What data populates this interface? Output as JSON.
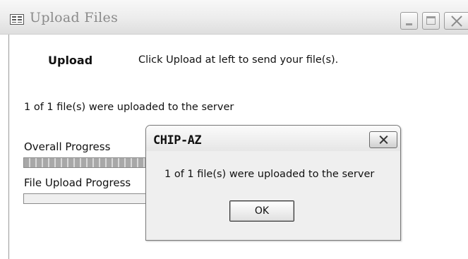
{
  "window": {
    "title": "Upload Files",
    "icon": "form-window-icon"
  },
  "content": {
    "upload_button_label": "Upload",
    "instructions": "Click Upload at left to send your file(s).",
    "status": "1 of 1 file(s) were uploaded to the server",
    "overall_progress_label": "Overall Progress",
    "overall_progress_fraction": 1.0,
    "file_progress_label": "File Upload Progress",
    "file_progress_fraction": 0.0
  },
  "dialog": {
    "title": "CHIP-AZ",
    "message": "1 of 1 file(s) were uploaded to the server",
    "ok_label": "OK"
  }
}
